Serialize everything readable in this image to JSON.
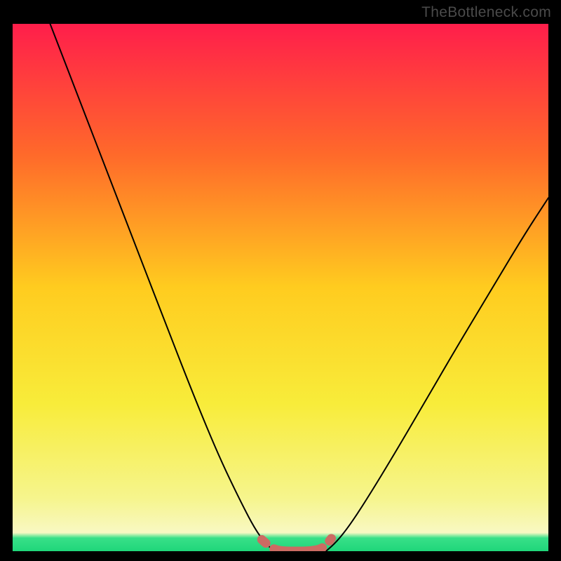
{
  "watermark": "TheBottleneck.com",
  "chart_data": {
    "type": "line",
    "title": "",
    "xlabel": "",
    "ylabel": "",
    "xlim": [
      0,
      100
    ],
    "ylim": [
      0,
      100
    ],
    "grid": false,
    "legend": false,
    "gradient_stops": [
      {
        "offset": 0,
        "color": "#ff1e4b"
      },
      {
        "offset": 0.25,
        "color": "#ff6a2a"
      },
      {
        "offset": 0.5,
        "color": "#ffcc1f"
      },
      {
        "offset": 0.72,
        "color": "#f8ec3a"
      },
      {
        "offset": 0.9,
        "color": "#f6f58d"
      },
      {
        "offset": 0.965,
        "color": "#f8f8c3"
      },
      {
        "offset": 0.975,
        "color": "#38e088"
      },
      {
        "offset": 1.0,
        "color": "#1fd67a"
      }
    ],
    "series": [
      {
        "name": "left-curve",
        "stroke": "#000000",
        "x": [
          7.0,
          12.5,
          18.0,
          23.5,
          29.0,
          34.0,
          38.5,
          42.5,
          45.5,
          47.8,
          49.2
        ],
        "y": [
          100.0,
          85.5,
          71.0,
          56.5,
          42.0,
          29.0,
          18.0,
          9.5,
          3.7,
          0.8,
          0.0
        ]
      },
      {
        "name": "right-curve",
        "stroke": "#000000",
        "x": [
          58.5,
          60.5,
          63.0,
          66.5,
          71.0,
          76.5,
          82.5,
          89.0,
          95.5,
          100.0
        ],
        "y": [
          0.0,
          1.8,
          5.0,
          10.5,
          18.0,
          27.5,
          38.0,
          49.0,
          60.0,
          67.0
        ]
      },
      {
        "name": "floor-segment",
        "stroke": "#cc6b63",
        "x": [
          46.5,
          48.5,
          50.5,
          53.0,
          55.5,
          58.0,
          59.5
        ],
        "y": [
          2.2,
          0.4,
          0.0,
          0.0,
          0.0,
          0.5,
          2.4
        ]
      }
    ],
    "annotations": []
  }
}
